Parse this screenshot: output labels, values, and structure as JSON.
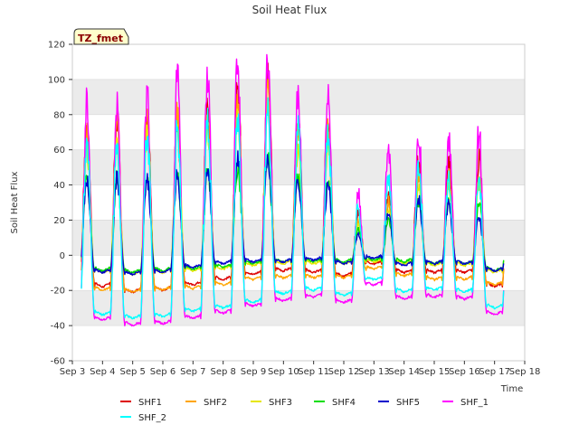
{
  "chart_data": {
    "type": "line",
    "title": "Soil Heat Flux",
    "xlabel": "Time",
    "ylabel": "Soil Heat Flux",
    "badge": "TZ_fmet",
    "xlim": [
      3,
      18
    ],
    "ylim": [
      -60,
      120
    ],
    "x_ticks": [
      3,
      4,
      5,
      6,
      7,
      8,
      9,
      10,
      11,
      12,
      13,
      14,
      15,
      16,
      17,
      18
    ],
    "x_tick_labels": [
      "Sep 3",
      "Sep 4",
      "Sep 5",
      "Sep 6",
      "Sep 7",
      "Sep 8",
      "Sep 9",
      "Sep 10",
      "Sep 11",
      "Sep 12",
      "Sep 13",
      "Sep 14",
      "Sep 15",
      "Sep 16",
      "Sep 17",
      "Sep 18"
    ],
    "y_ticks": [
      -60,
      -40,
      -20,
      0,
      20,
      40,
      60,
      80,
      100,
      120
    ],
    "y_tick_labels": [
      "-60",
      "-40",
      "-20",
      "0",
      "20",
      "40",
      "60",
      "80",
      "100",
      "120"
    ],
    "grid": "horizontal bands",
    "legend_position": "bottom",
    "x_start": 3.3,
    "x_end": 17.3,
    "series": [
      {
        "name": "SHF1",
        "color": "#dd0000",
        "night": [
          -15,
          -18,
          -21,
          -20,
          -17,
          -14,
          -11,
          -9,
          -10,
          -12,
          -5,
          -10,
          -10,
          -10,
          -18,
          -7
        ],
        "peak": [
          75,
          78,
          80,
          80,
          85,
          95,
          100,
          75,
          80,
          25,
          35,
          55,
          55,
          55,
          60
        ]
      },
      {
        "name": "SHF2",
        "color": "#ffa500",
        "night": [
          -19,
          -20,
          -21,
          -20,
          -19,
          -17,
          -14,
          -13,
          -13,
          -13,
          -8,
          -12,
          -14,
          -14,
          -17,
          -13
        ],
        "peak": [
          70,
          75,
          78,
          80,
          82,
          88,
          95,
          70,
          72,
          20,
          30,
          45,
          45,
          45,
          50
        ]
      },
      {
        "name": "SHF3",
        "color": "#e6e600",
        "night": [
          -9,
          -10,
          -11,
          -10,
          -9,
          -8,
          -6,
          -5,
          -5,
          -5,
          -4,
          -5,
          -6,
          -6,
          -10,
          -6
        ],
        "peak": [
          60,
          65,
          68,
          70,
          72,
          78,
          85,
          60,
          62,
          18,
          25,
          40,
          40,
          40,
          45
        ]
      },
      {
        "name": "SHF4",
        "color": "#00dd00",
        "night": [
          -8,
          -9,
          -10,
          -9,
          -8,
          -7,
          -5,
          -4,
          -4,
          -4,
          -3,
          -4,
          -5,
          -5,
          -9,
          -4
        ],
        "peak": [
          45,
          45,
          45,
          45,
          48,
          50,
          55,
          45,
          45,
          15,
          20,
          30,
          30,
          30,
          35
        ]
      },
      {
        "name": "SHF5",
        "color": "#0000cc",
        "night": [
          -7,
          -10,
          -11,
          -10,
          -7,
          -5,
          -4,
          -4,
          -3,
          -5,
          -2,
          -6,
          -5,
          -5,
          -9,
          -4
        ],
        "peak": [
          43,
          44,
          42,
          47,
          50,
          55,
          57,
          42,
          40,
          12,
          25,
          32,
          30,
          21,
          25
        ]
      },
      {
        "name": "SHF_1",
        "color": "#ff00ff",
        "night": [
          -32,
          -37,
          -40,
          -39,
          -36,
          -33,
          -29,
          -26,
          -24,
          -27,
          -17,
          -25,
          -24,
          -25,
          -34,
          -20
        ],
        "peak": [
          86,
          89,
          91,
          101,
          103,
          109,
          110,
          94,
          91,
          36,
          61,
          70,
          67,
          70,
          69
        ]
      },
      {
        "name": "SHF_2",
        "color": "#00ffff",
        "night": [
          -30,
          -34,
          -36,
          -35,
          -32,
          -30,
          -27,
          -22,
          -20,
          -23,
          -14,
          -21,
          -20,
          -21,
          -30,
          -18
        ],
        "peak": [
          64,
          66,
          70,
          74,
          77,
          79,
          81,
          72,
          68,
          28,
          45,
          52,
          44,
          45,
          45
        ]
      }
    ]
  }
}
